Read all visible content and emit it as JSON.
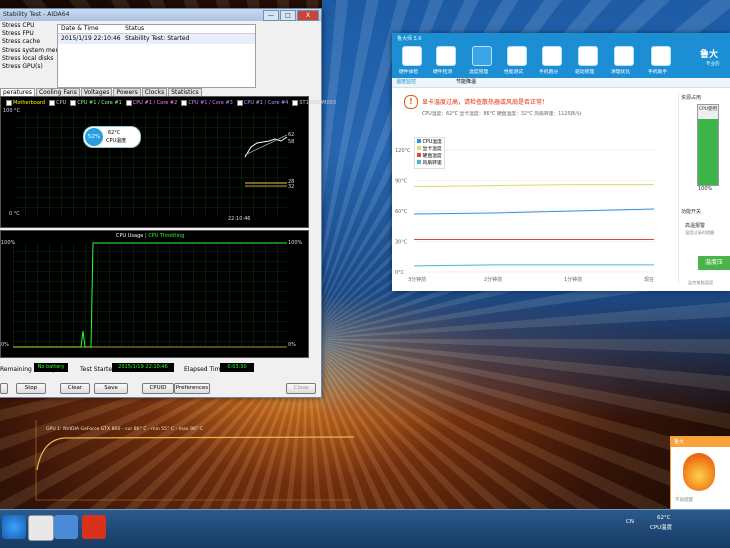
{
  "aida": {
    "title": "Stability Test - AIDA64",
    "window_buttons": {
      "min": "—",
      "max": "□",
      "close": "X"
    },
    "stress_items": [
      "Stress CPU",
      "Stress FPU",
      "Stress cache",
      "Stress system memory",
      "Stress local disks",
      "Stress GPU(s)"
    ],
    "status_table": {
      "col_datetime": "Date & Time",
      "col_status": "Status",
      "rows": [
        {
          "datetime": "2015/1/19 22:10:46",
          "status": "Stability Test: Started"
        }
      ]
    },
    "tabs": [
      "peratures",
      "Cooling Fans",
      "Voltages",
      "Powers",
      "Clocks",
      "Statistics"
    ],
    "legend": [
      "Motherboard",
      "CPU",
      "CPU #1 / Core #1",
      "CPU #1 / Core #2",
      "CPU #1 / Core #3",
      "CPU #1 / Core #4",
      "ST1000DM003"
    ],
    "temp_graph": {
      "y_top": "100 °C",
      "y_bottom": "0 °C",
      "time": "22:10:46",
      "right_val1": "62",
      "right_val2": "58",
      "right_val3": "28",
      "right_val4": "32"
    },
    "badge": {
      "pct": "52%",
      "temp": "62°C",
      "label": "CPU温度"
    },
    "usage_graph": {
      "title_usage": "CPU Usage",
      "sep": "|",
      "title_throttle": "CPU Throttling",
      "y_top_left": "100%",
      "y_bottom_left": "0%",
      "y_top_right": "100%",
      "y_bottom_right": "0%"
    },
    "bottom": {
      "battery_label": "Remaining Battery:",
      "battery_value": "No battery",
      "started_label": "Test Started:",
      "started_value": "2015/1/19 22:10:46",
      "elapsed_label": "Elapsed Time:",
      "elapsed_value": "0:03:30"
    },
    "buttons": [
      "Start",
      "Stop",
      "Clear",
      "Save",
      "CPUID",
      "Preferences",
      "Close"
    ]
  },
  "ludashi": {
    "title": "鲁大师 5.6",
    "brand": "鲁大",
    "brand_sub": "专业的",
    "nav": [
      "硬件体检",
      "硬件检测",
      "温度管理",
      "性能测试",
      "手机跑分",
      "驱动管理",
      "清理优化",
      "手机助手"
    ],
    "subtabs": [
      "温度监控",
      "节能降温"
    ],
    "alert": "显卡温度过高，请检查散热器或风扇是否正常！",
    "status_line": "CPU温度：62°C  显卡温度：86°C  硬盘温度：32°C  风扇转速：1125转/分",
    "chart_legend": [
      "CPU温度",
      "显卡温度",
      "硬盘温度",
      "风扇转速"
    ],
    "right_title": "资源占用",
    "right_cpu": "CPU使用",
    "right_pct": "100%",
    "right_func": "功能开关",
    "right_alarm": "高温报警",
    "right_alarm_note": "温度过高时提醒",
    "right_btn": "温度压",
    "right_note": "监控电脑温度",
    "colors": {
      "cpu": "#3b8fd8",
      "gpu": "#e5d66a",
      "disk": "#e2453b",
      "fan": "#4ab9c9"
    }
  },
  "chart_data": {
    "type": "line",
    "title": "",
    "ylabel": "",
    "ylim": [
      0,
      120
    ],
    "y_ticks": [
      "120°C",
      "90°C",
      "60°C",
      "30°C",
      "0°C"
    ],
    "x_ticks": [
      "3分钟前",
      "2分钟前",
      "1分钟前",
      "现在"
    ],
    "x": [
      0,
      1,
      2,
      3
    ],
    "series": [
      {
        "name": "CPU温度",
        "values": [
          57,
          58,
          60,
          62
        ]
      },
      {
        "name": "显卡温度",
        "values": [
          84,
          85,
          86,
          86
        ]
      },
      {
        "name": "硬盘温度",
        "values": [
          32,
          32,
          32,
          32
        ]
      },
      {
        "name": "风扇转速",
        "values": [
          6,
          7,
          7,
          7
        ]
      }
    ]
  },
  "gpu_graph": {
    "label": "GPU 1: NVIDIA GeForce GTX 860 - cur 86° C - min 55° C - max 86° C"
  },
  "popup": {
    "title": "鲁大",
    "footer": "不再提醒"
  },
  "taskbar": {
    "temp": "62°C",
    "temp_label": "CPU温度",
    "lang": "CN"
  }
}
